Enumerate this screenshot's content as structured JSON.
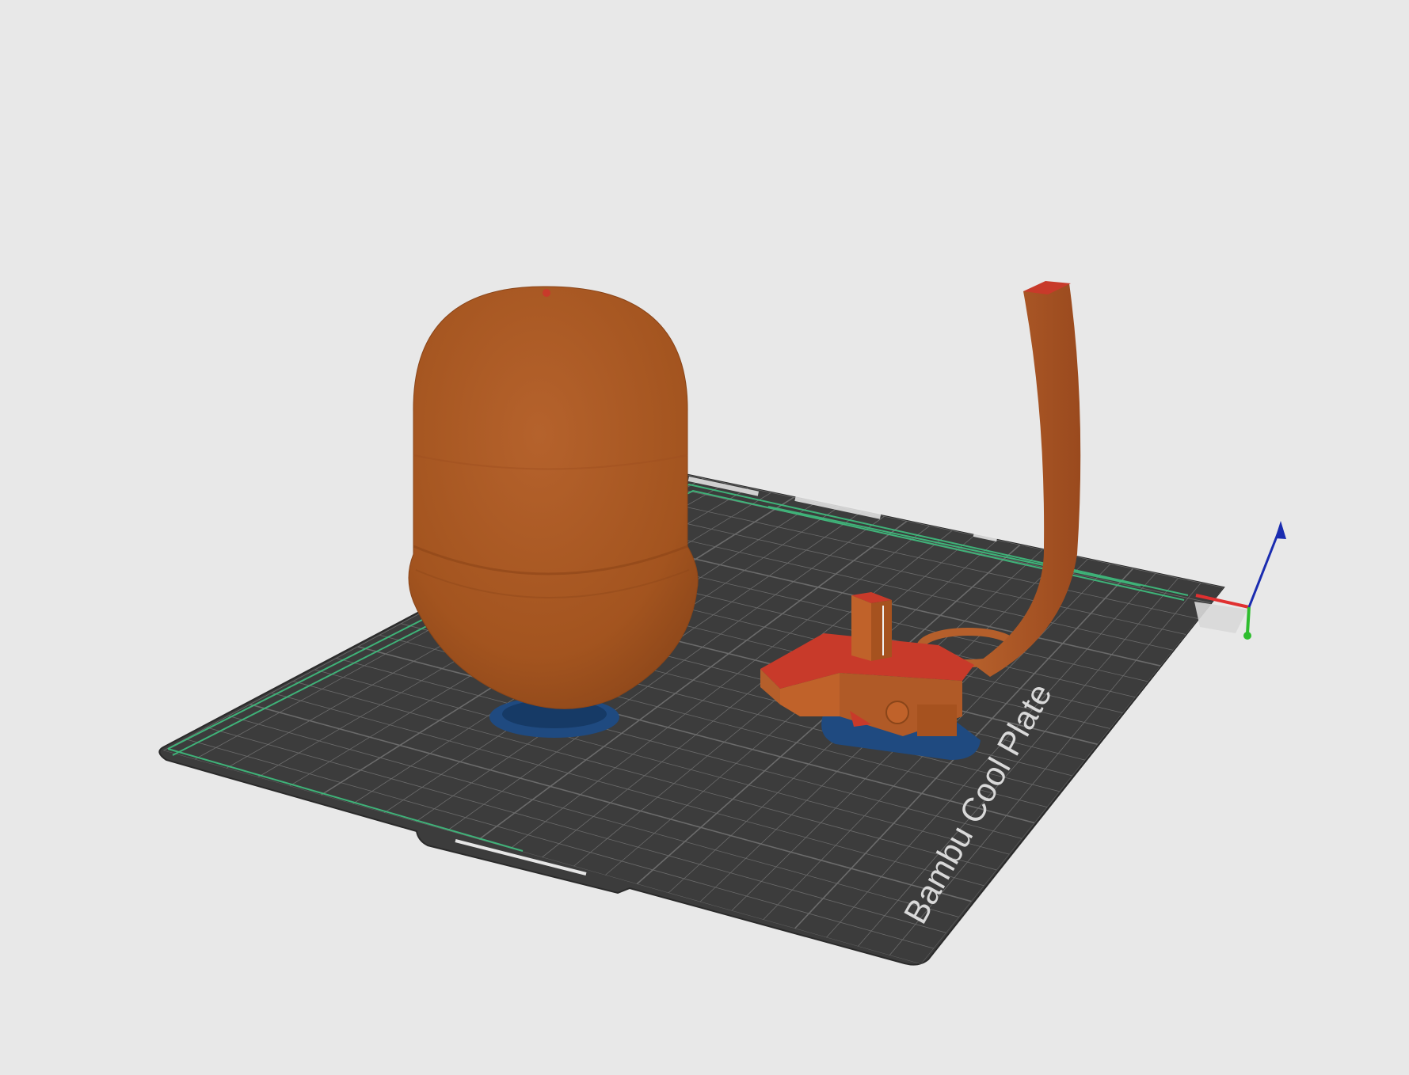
{
  "app": {
    "view": "slicer-3d-preview"
  },
  "plate": {
    "label": "Bambu Cool Plate",
    "surface_color": "#3c3c3c",
    "grid_color": "#6b6b6b",
    "skirt_color": "#3fbf7f",
    "text_color": "#d9d9d9"
  },
  "objects": [
    {
      "name": "capsule-model",
      "color": "#a85a2a",
      "brim_color": "#1f4a80"
    },
    {
      "name": "bracket-with-arm-model",
      "color": "#c0622a",
      "top_color": "#c83a2a",
      "brim_color": "#1f4a80"
    }
  ],
  "axes": {
    "x_color": "#e03030",
    "y_color": "#2ebd2e",
    "z_color": "#1a2cb0"
  },
  "background_color": "#e8e8e8"
}
